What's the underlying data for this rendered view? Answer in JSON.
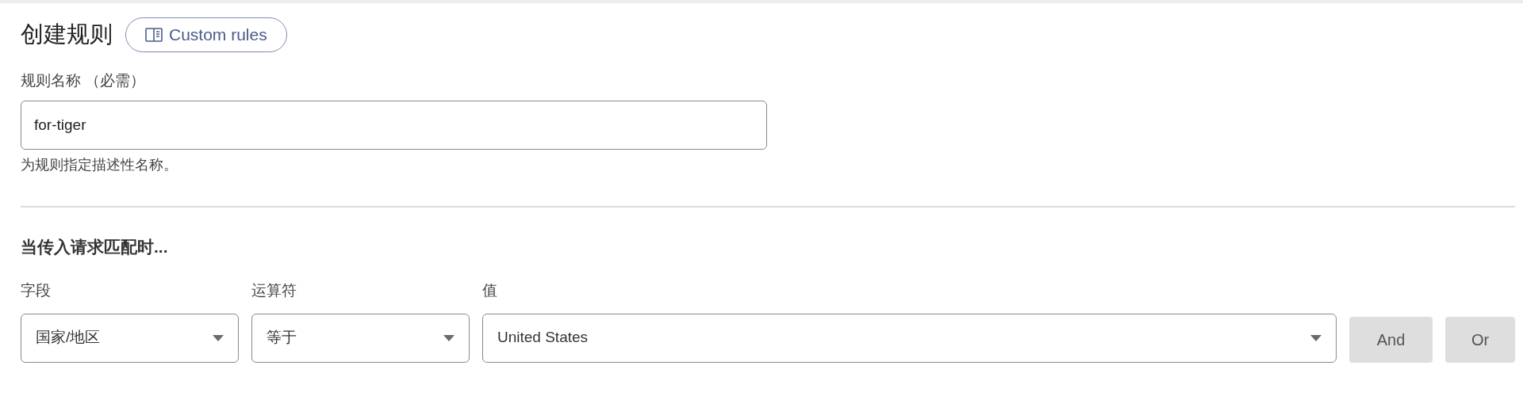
{
  "title": "创建规则",
  "custom_rules_button": {
    "label": "Custom rules"
  },
  "rule_name": {
    "label": "规则名称 （必需）",
    "value": "for-tiger",
    "hint": "为规则指定描述性名称。"
  },
  "section_heading": "当传入请求匹配时...",
  "condition": {
    "fields": [
      {
        "label": "字段",
        "value": "国家/地区",
        "kind": "select"
      },
      {
        "label": "运算符",
        "value": "等于",
        "kind": "select"
      },
      {
        "label": "值",
        "value": "United States",
        "kind": "select"
      }
    ],
    "buttons": [
      {
        "label": "And",
        "disabled": true
      },
      {
        "label": "Or",
        "disabled": true
      }
    ]
  }
}
